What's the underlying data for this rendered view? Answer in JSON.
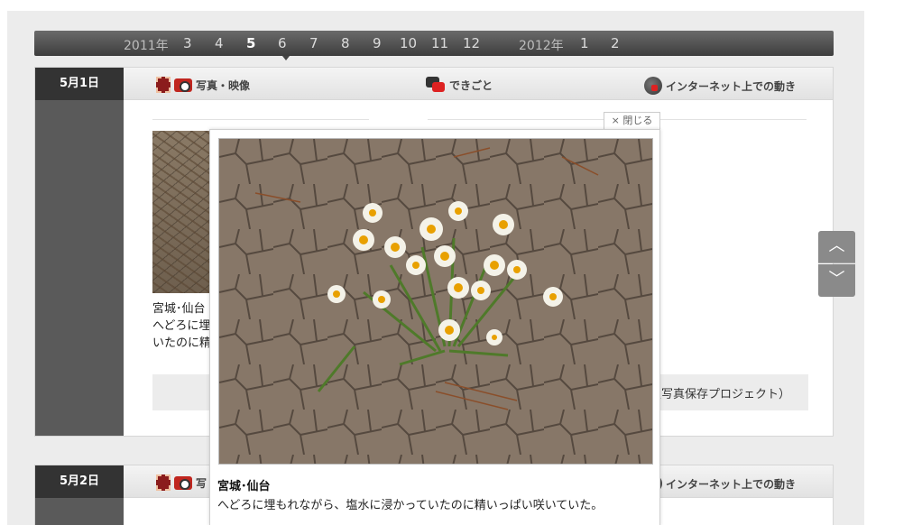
{
  "timeline": {
    "year_2011": "2011年",
    "months_2011": [
      "3",
      "4",
      "5",
      "6",
      "7",
      "8",
      "9",
      "10",
      "11",
      "12"
    ],
    "year_2012": "2012年",
    "months_2012": [
      "1",
      "2"
    ],
    "active_month": "5"
  },
  "days": [
    {
      "date": "5月1日",
      "photo_label": "写真・映像",
      "events_label": "できごと",
      "internet_label": "インターネット上での動き",
      "thumb_caption_lines": [
        "宮城･仙台",
        "へどろに埋",
        "いたのに精"
      ],
      "credit": "災写真保存プロジェクト）"
    },
    {
      "date": "5月2日",
      "photo_label": "写",
      "internet_label": "インターネット上での動き"
    }
  ],
  "popup": {
    "close_label": "× 閉じる",
    "caption_title": "宮城･仙台",
    "caption_body": "へどろに埋もれながら、塩水に浸かっていたのに精いっぱい咲いていた。"
  },
  "scroll": {
    "up_icon": "chevron-up-icon",
    "down_icon": "chevron-down-icon"
  },
  "colors": {
    "timeline_bg": "#4a4a4a",
    "day_label_bg": "#333333",
    "sidebar_bg": "#5a5a5a",
    "accent_red": "#c0261f"
  }
}
